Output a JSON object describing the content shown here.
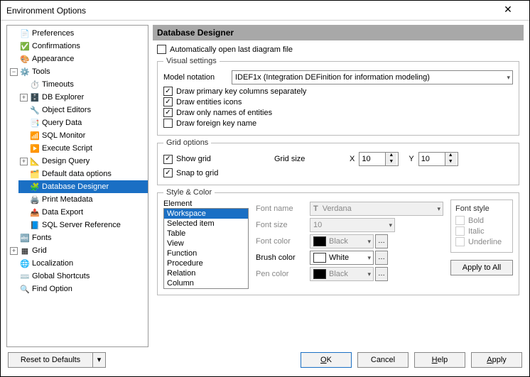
{
  "window": {
    "title": "Environment Options"
  },
  "tree": {
    "preferences": "Preferences",
    "confirmations": "Confirmations",
    "appearance": "Appearance",
    "tools": "Tools",
    "timeouts": "Timeouts",
    "dbexplorer": "DB Explorer",
    "objecteditors": "Object Editors",
    "querydata": "Query Data",
    "sqlmonitor": "SQL Monitor",
    "executescript": "Execute Script",
    "designquery": "Design Query",
    "defaultdata": "Default data options",
    "databasedesigner": "Database Designer",
    "printmetadata": "Print Metadata",
    "dataexport": "Data Export",
    "sqlserverref": "SQL Server Reference",
    "fonts": "Fonts",
    "grid": "Grid",
    "localization": "Localization",
    "globalshortcuts": "Global Shortcuts",
    "findoption": "Find Option"
  },
  "header": "Database Designer",
  "autoopen": {
    "label": "Automatically open last diagram file",
    "checked": false
  },
  "visual": {
    "title": "Visual settings",
    "notation_label": "Model notation",
    "notation_value": "IDEF1x (Integration DEFinition for information modeling)",
    "draw_pk": {
      "label": "Draw primary key columns separately",
      "checked": true
    },
    "draw_icons": {
      "label": "Draw entities icons",
      "checked": true
    },
    "draw_names": {
      "label": "Draw only names of entities",
      "checked": true
    },
    "draw_fk": {
      "label": "Draw foreign key name",
      "checked": false
    }
  },
  "grid": {
    "title": "Grid options",
    "show": {
      "label": "Show grid",
      "checked": true
    },
    "snap": {
      "label": "Snap to grid",
      "checked": true
    },
    "size_label": "Grid size",
    "x_label": "X",
    "x_value": "10",
    "y_label": "Y",
    "y_value": "10"
  },
  "style": {
    "title": "Style & Color",
    "element_label": "Element",
    "elements": [
      "Workspace",
      "Selected item",
      "Table",
      "View",
      "Function",
      "Procedure",
      "Relation",
      "Column"
    ],
    "selected_element": "Workspace",
    "fontname_label": "Font name",
    "fontname_value": "Verdana",
    "fontsize_label": "Font size",
    "fontsize_value": "10",
    "fontcolor_label": "Font color",
    "fontcolor_value": "Black",
    "fontcolor_hex": "#000000",
    "brushcolor_label": "Brush color",
    "brushcolor_value": "White",
    "brushcolor_hex": "#ffffff",
    "pencolor_label": "Pen color",
    "pencolor_value": "Black",
    "pencolor_hex": "#000000",
    "fontstyle_label": "Font style",
    "bold": "Bold",
    "italic": "Italic",
    "underline": "Underline",
    "apply_all": "Apply to All"
  },
  "footer": {
    "reset": "Reset to Defaults",
    "ok": "OK",
    "cancel": "Cancel",
    "help": "Help",
    "apply": "Apply"
  }
}
